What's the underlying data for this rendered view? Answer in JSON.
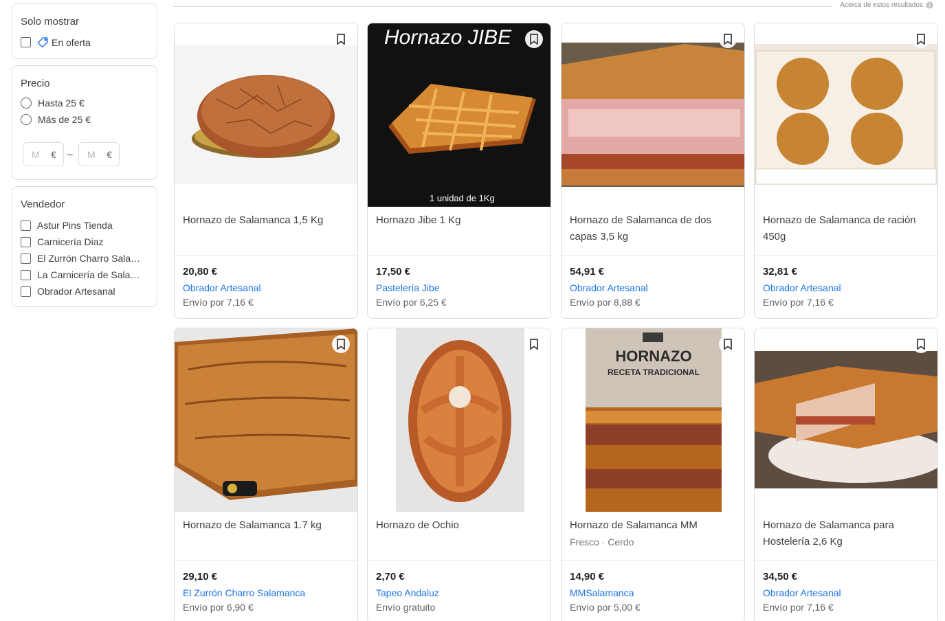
{
  "sidebar": {
    "only_show": {
      "title": "Solo mostrar",
      "options": [
        {
          "label": "En oferta"
        }
      ]
    },
    "price": {
      "title": "Precio",
      "options": [
        {
          "label": "Hasta 25 €"
        },
        {
          "label": "Más de 25 €"
        }
      ],
      "min_placeholder": "M",
      "max_placeholder": "M",
      "currency": "€",
      "range_separator": "–"
    },
    "seller": {
      "title": "Vendedor",
      "options": [
        {
          "label": "Astur Pins Tienda"
        },
        {
          "label": "Carnicería Diaz"
        },
        {
          "label": "El Zurrón Charro Salamanca"
        },
        {
          "label": "La Carnicería de Salamanca"
        },
        {
          "label": "Obrador Artesanal"
        }
      ]
    }
  },
  "results_header": {
    "about": "Acerca de estos resultados"
  },
  "products": [
    {
      "title": "Hornazo de Salamanca 1,5 Kg",
      "subtitle": "",
      "price": "20,80 €",
      "seller": "Obrador Artesanal",
      "shipping": "Envío por 7,16 €",
      "image_text": ""
    },
    {
      "title": "Hornazo Jibe 1 Kg",
      "subtitle": "",
      "price": "17,50 €",
      "seller": "Pastelería Jibe",
      "shipping": "Envío por 6,25 €",
      "image_text": "Hornazo JIBE",
      "image_caption": "1 unidad de 1Kg"
    },
    {
      "title": "Hornazo de Salamanca de dos capas 3,5 kg",
      "subtitle": "",
      "price": "54,91 €",
      "seller": "Obrador Artesanal",
      "shipping": "Envío por 8,88 €",
      "image_text": ""
    },
    {
      "title": "Hornazo de Salamanca de ración 450g",
      "subtitle": "",
      "price": "32,81 €",
      "seller": "Obrador Artesanal",
      "shipping": "Envío por 7,16 €",
      "image_text": ""
    },
    {
      "title": "Hornazo de Salamanca 1.7 kg",
      "subtitle": "",
      "price": "29,10 €",
      "seller": "El Zurrón Charro Salamanca",
      "shipping": "Envío por 6,90 €",
      "image_text": ""
    },
    {
      "title": "Hornazo de Ochio",
      "subtitle": "",
      "price": "2,70 €",
      "seller": "Tapeo Andaluz",
      "shipping": "Envío gratuito",
      "image_text": ""
    },
    {
      "title": "Hornazo de Salamanca MM",
      "subtitle": "Fresco · Cerdo",
      "price": "14,90 €",
      "seller": "MMSalamanca",
      "shipping": "Envío por 5,00 €",
      "image_text": "HORNAZO",
      "image_caption": "RECETA TRADICIONAL"
    },
    {
      "title": "Hornazo de Salamanca para Hostelería 2,6 Kg",
      "subtitle": "",
      "price": "34,50 €",
      "seller": "Obrador Artesanal",
      "shipping": "Envío por 7,16 €",
      "image_text": ""
    }
  ],
  "icons": {
    "tag": "tag-icon",
    "bookmark": "bookmark-icon",
    "info": "info-icon"
  },
  "colors": {
    "link": "#1a73e8",
    "border": "#dadce0",
    "tag_icon": "#1a73e8"
  }
}
